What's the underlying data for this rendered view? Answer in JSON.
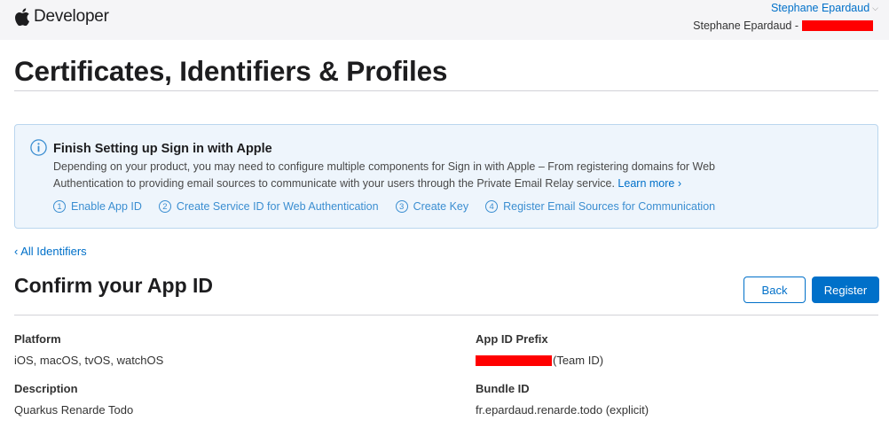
{
  "header": {
    "brand": "Developer",
    "user_name": "Stephane Epardaud",
    "team_label": "Stephane Epardaud -",
    "redaction_color": "#ff0000"
  },
  "page": {
    "title": "Certificates, Identifiers & Profiles"
  },
  "banner": {
    "icon": "info-icon",
    "title": "Finish Setting up Sign in with Apple",
    "text": "Depending on your product, you may need to configure multiple components for Sign in with Apple – From registering domains for Web Authentication to providing email sources to communicate with your users through the Private Email Relay service.",
    "learn_more": "Learn more ›",
    "steps": [
      {
        "num": "1",
        "label": "Enable App ID"
      },
      {
        "num": "2",
        "label": "Create Service ID for Web Authentication"
      },
      {
        "num": "3",
        "label": "Create Key"
      },
      {
        "num": "4",
        "label": "Register Email Sources for Communication"
      }
    ]
  },
  "nav": {
    "back_link": "‹ All Identifiers"
  },
  "section": {
    "title": "Confirm your App ID",
    "back_button": "Back",
    "register_button": "Register"
  },
  "details": {
    "platform": {
      "label": "Platform",
      "value": "iOS, macOS, tvOS, watchOS"
    },
    "app_id_prefix": {
      "label": "App ID Prefix",
      "value": "(Team ID)"
    },
    "description": {
      "label": "Description",
      "value": "Quarkus Renarde Todo"
    },
    "bundle_id": {
      "label": "Bundle ID",
      "value": "fr.epardaud.renarde.todo (explicit)"
    }
  },
  "colors": {
    "accent": "#0070c9",
    "banner_bg": "#eef5fc",
    "topbar_bg": "#f5f5f7"
  }
}
